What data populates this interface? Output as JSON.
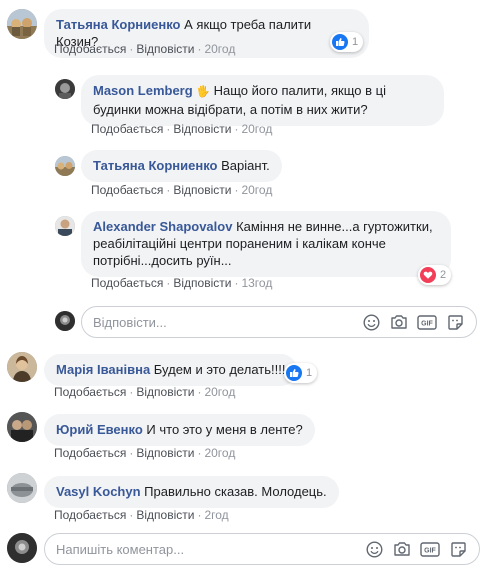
{
  "comments": [
    {
      "author": "Татьяна Корниенко",
      "text": "А якщо треба палити Козин?",
      "like": "Подобається",
      "reply": "Відповісти",
      "time": "20год",
      "reaction_count": "1",
      "reaction_type": "like"
    },
    {
      "author": "Mason Lemberg",
      "badge": "🖐",
      "text": "Нащо його палити, якщо в ці будинки можна відібрати, а потім в них жити?",
      "like": "Подобається",
      "reply": "Відповісти",
      "time": "20год"
    },
    {
      "author": "Татьяна Корниенко",
      "text": "Варіант.",
      "like": "Подобається",
      "reply": "Відповісти",
      "time": "20год"
    },
    {
      "author": "Alexander Shapovalov",
      "text": "Каміння не винне...а гуртожитки, реабілітаційні центри пораненим і калікам конче потрібні...досить руїн...",
      "like": "Подобається",
      "reply": "Відповісти",
      "time": "13год",
      "reaction_count": "2",
      "reaction_type": "love"
    },
    {
      "author": "Марія Іванівна",
      "text": "Будем и это делать!!!!",
      "like": "Подобається",
      "reply": "Відповісти",
      "time": "20год",
      "reaction_count": "1",
      "reaction_type": "like"
    },
    {
      "author": "Юрий Евенко",
      "text": "И что это у меня в ленте?",
      "like": "Подобається",
      "reply": "Відповісти",
      "time": "20год"
    },
    {
      "author": "Vasyl Kochyn",
      "text": "Правильно сказав. Молодець.",
      "like": "Подобається",
      "reply": "Відповісти",
      "time": "2год"
    }
  ],
  "reply_input": {
    "placeholder": "Відповісти..."
  },
  "comment_input": {
    "placeholder": "Напишіть коментар..."
  },
  "separator": "·",
  "icons": [
    "emoji-icon",
    "camera-icon",
    "gif-icon",
    "sticker-icon"
  ],
  "colors": {
    "name": "#385898",
    "bubble": "#f2f3f5",
    "meta": "#90949c",
    "like_blue": "#1877f2",
    "love_red": "#f33e58"
  }
}
